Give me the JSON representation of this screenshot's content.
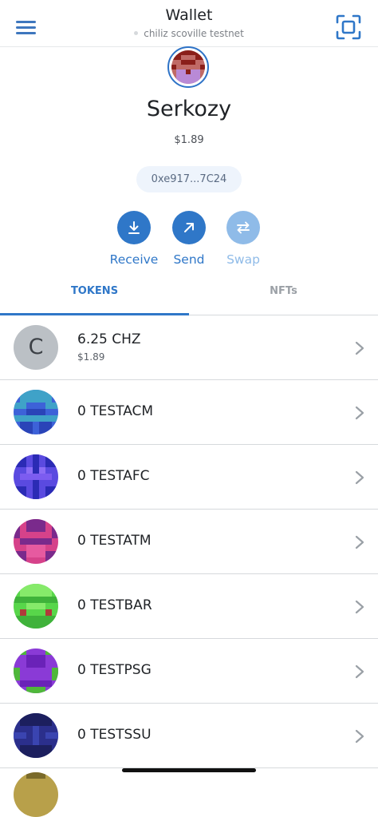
{
  "header": {
    "title": "Wallet",
    "network": "chiliz scoville testnet",
    "menu_icon": "hamburger-icon",
    "scan_icon": "scan-icon"
  },
  "account": {
    "name": "Serkozy",
    "balance": "$1.89",
    "address": "0xe917...7C24"
  },
  "actions": [
    {
      "label": "Receive",
      "icon": "receive-icon",
      "enabled": true
    },
    {
      "label": "Send",
      "icon": "send-icon",
      "enabled": true
    },
    {
      "label": "Swap",
      "icon": "swap-icon",
      "enabled": false
    }
  ],
  "tabs": [
    {
      "label": "TOKENS",
      "active": true
    },
    {
      "label": "NFTs",
      "active": false
    }
  ],
  "tokens": [
    {
      "amount": "6.25 CHZ",
      "fiat": "$1.89",
      "icon_letter": "C"
    },
    {
      "amount": "0 TESTACM"
    },
    {
      "amount": "0 TESTAFC"
    },
    {
      "amount": "0 TESTATM"
    },
    {
      "amount": "0 TESTBAR"
    },
    {
      "amount": "0 TESTPSG"
    },
    {
      "amount": "0 TESTSSU"
    }
  ],
  "colors": {
    "accent": "#2f77c8",
    "accent_disabled": "#8fbbe8",
    "divider": "#d6d9dc"
  }
}
